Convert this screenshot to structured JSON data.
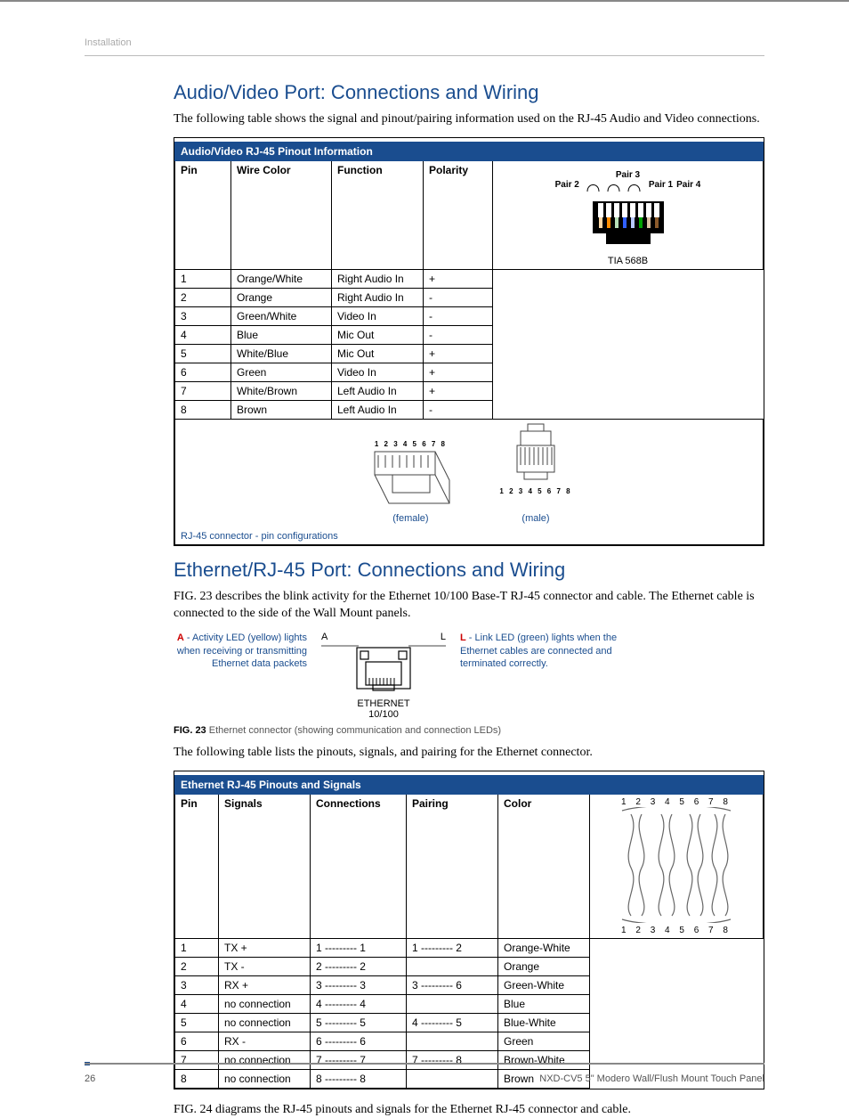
{
  "header_label": "Installation",
  "section1": {
    "title": "Audio/Video Port: Connections and Wiring",
    "intro": "The following table shows the signal and pinout/pairing information used on the RJ-45 Audio and Video connections.",
    "table_title": "Audio/Video RJ-45 Pinout Information",
    "headers": {
      "pin": "Pin",
      "wire": "Wire Color",
      "function": "Function",
      "polarity": "Polarity"
    },
    "rows": [
      {
        "pin": "1",
        "wire": "Orange/White",
        "function": "Right Audio In",
        "polarity": "+"
      },
      {
        "pin": "2",
        "wire": "Orange",
        "function": "Right Audio In",
        "polarity": "-"
      },
      {
        "pin": "3",
        "wire": "Green/White",
        "function": "Video In",
        "polarity": "-"
      },
      {
        "pin": "4",
        "wire": "Blue",
        "function": "Mic Out",
        "polarity": "-"
      },
      {
        "pin": "5",
        "wire": "White/Blue",
        "function": "Mic Out",
        "polarity": "+"
      },
      {
        "pin": "6",
        "wire": "Green",
        "function": "Video In",
        "polarity": "+"
      },
      {
        "pin": "7",
        "wire": "White/Brown",
        "function": "Left Audio In",
        "polarity": "+"
      },
      {
        "pin": "8",
        "wire": "Brown",
        "function": "Left Audio In",
        "polarity": "-"
      }
    ],
    "diagram_labels": {
      "pair1": "Pair 1",
      "pair2": "Pair 2",
      "pair3": "Pair 3",
      "pair4": "Pair 4",
      "std": "TIA 568B",
      "pins": "1 2 3 4 5 6 7 8",
      "female": "(female)",
      "male": "(male)",
      "caption": "RJ-45 connector - pin configurations"
    }
  },
  "section2": {
    "title": "Ethernet/RJ-45 Port: Connections and Wiring",
    "intro": "FIG. 23 describes the blink activity for the Ethernet 10/100 Base-T RJ-45 connector and cable. The Ethernet cable is connected to the side of the Wall Mount panels.",
    "fig23": {
      "a_desc_bold": "A",
      "a_desc_rest": " - Activity LED (yellow) lights when receiving or transmitting Ethernet data packets",
      "l_desc_bold": "L",
      "l_desc_rest": " - Link LED (green) lights when the Ethernet cables are connected and terminated correctly.",
      "center_a": "A",
      "center_l": "L",
      "center_label1": "ETHERNET",
      "center_label2": "10/100",
      "caption_bold": "FIG. 23",
      "caption_rest": "  Ethernet connector (showing communication and connection LEDs)"
    },
    "mid_text": "The following table lists the pinouts, signals, and pairing for the Ethernet connector.",
    "table_title": "Ethernet RJ-45 Pinouts and Signals",
    "headers": {
      "pin": "Pin",
      "signals": "Signals",
      "connections": "Connections",
      "pairing": "Pairing",
      "color": "Color"
    },
    "rows": [
      {
        "pin": "1",
        "signals": "TX +",
        "connections": "1 --------- 1",
        "pairing": "1 --------- 2",
        "color": "Orange-White"
      },
      {
        "pin": "2",
        "signals": "TX -",
        "connections": "2 --------- 2",
        "pairing": "",
        "color": "Orange"
      },
      {
        "pin": "3",
        "signals": "RX +",
        "connections": "3 --------- 3",
        "pairing": "3 --------- 6",
        "color": "Green-White"
      },
      {
        "pin": "4",
        "signals": "no connection",
        "connections": "4 --------- 4",
        "pairing": "",
        "color": "Blue"
      },
      {
        "pin": "5",
        "signals": "no connection",
        "connections": "5 --------- 5",
        "pairing": "4 --------- 5",
        "color": "Blue-White"
      },
      {
        "pin": "6",
        "signals": "RX -",
        "connections": "6 --------- 6",
        "pairing": "",
        "color": "Green"
      },
      {
        "pin": "7",
        "signals": "no connection",
        "connections": "7 --------- 7",
        "pairing": "7 --------- 8",
        "color": "Brown-White"
      },
      {
        "pin": "8",
        "signals": "no connection",
        "connections": "8 --------- 8",
        "pairing": "",
        "color": "Brown"
      }
    ],
    "pair_diagram_pins": "1 2 3  4 5 6  7 8",
    "outro": "FIG. 24 diagrams the RJ-45 pinouts and signals for the Ethernet RJ-45 connector and cable."
  },
  "footer": {
    "page": "26",
    "doc": "NXD-CV5 5\" Modero Wall/Flush Mount Touch Panel"
  }
}
